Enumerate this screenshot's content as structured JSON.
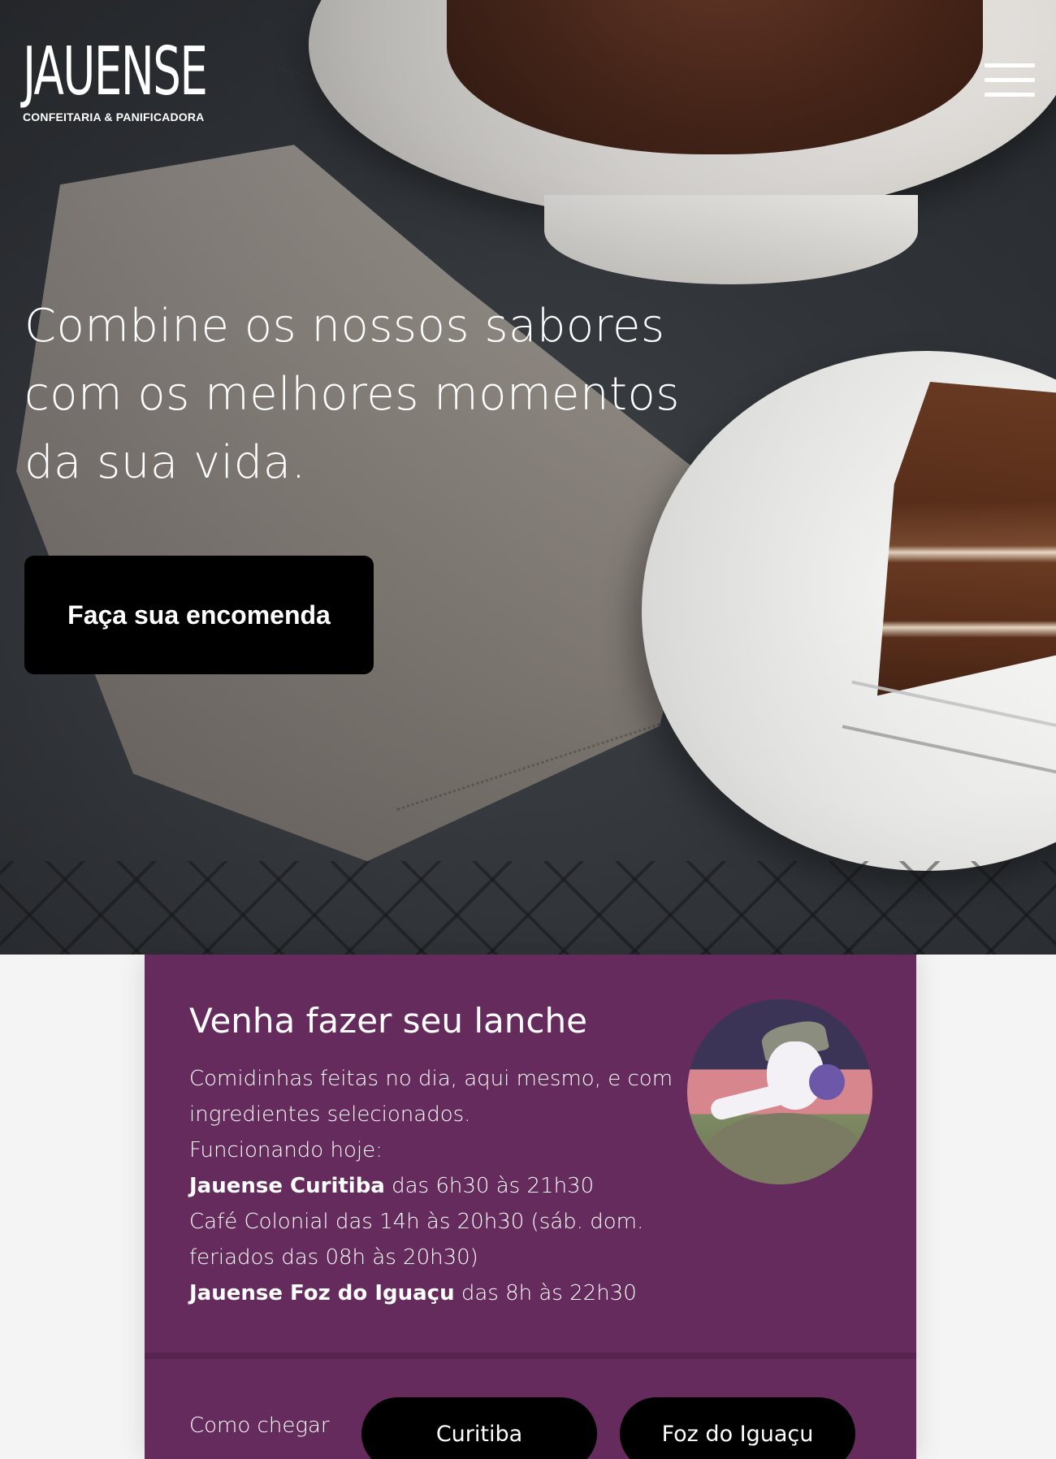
{
  "brand": {
    "name": "JAUENSE",
    "tagline": "CONFEITARIA & PANIFICADORA"
  },
  "hero": {
    "title": "Combine os nossos sabores com os melhores momentos da sua vida.",
    "cta_label": "Faça sua encomenda"
  },
  "lanche": {
    "title": "Venha fazer seu lanche",
    "intro": "Comidinhas feitas no dia, aqui mesmo, e com ingredientes selecionados.",
    "today_label": "Funcionando hoje:",
    "curitiba_name": "Jauense Curitiba",
    "curitiba_hours": "das 6h30 às 21h30",
    "cafe_colonial": "Café Colonial das 14h às 20h30 (sáb. dom. feriados das 08h às 20h30)",
    "foz_name": "Jauense Foz do Iguaçu",
    "foz_hours": "das 8h às 22h30"
  },
  "directions": {
    "label": "Como chegar",
    "buttons": [
      "Curitiba",
      "Foz do Iguaçu"
    ]
  },
  "colors": {
    "card_bg": "#652b5d",
    "button_bg": "#000000",
    "text_light": "#ffffff"
  }
}
